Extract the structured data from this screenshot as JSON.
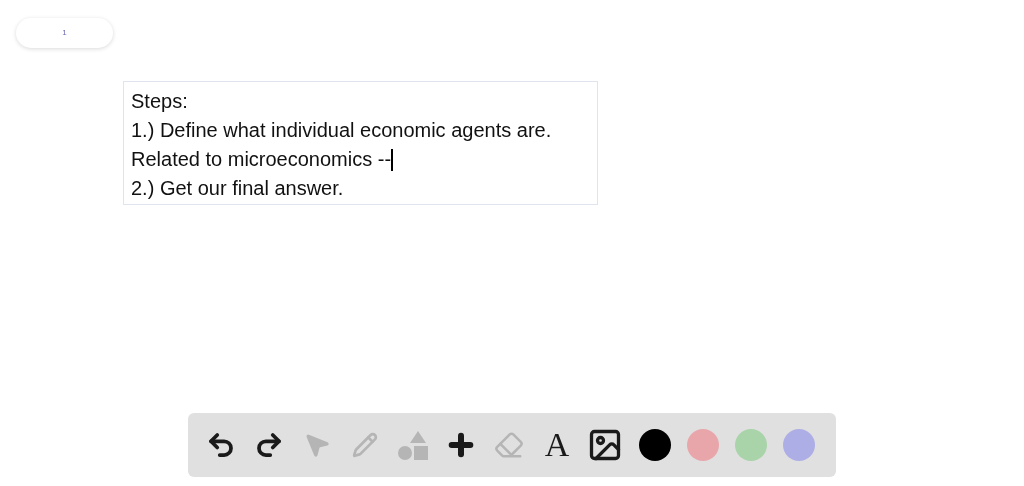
{
  "page_badge": "1",
  "text_box": {
    "lines": [
      "Steps:",
      "1.) Define what individual economic agents are.",
      "Related to microeconomics --",
      "2.) Get our final answer."
    ]
  },
  "toolbar": {
    "tools": [
      {
        "kind": "undo",
        "disabled": false
      },
      {
        "kind": "redo",
        "disabled": false
      },
      {
        "kind": "select",
        "disabled": true
      },
      {
        "kind": "pencil",
        "disabled": true
      },
      {
        "kind": "shapes",
        "disabled": true
      },
      {
        "kind": "add",
        "disabled": false
      },
      {
        "kind": "eraser",
        "disabled": true
      },
      {
        "kind": "text",
        "disabled": false,
        "label": "A"
      },
      {
        "kind": "image",
        "disabled": false
      }
    ],
    "colors": [
      {
        "color": "#000000"
      },
      {
        "color": "#e8a6ab"
      },
      {
        "color": "#a9d3a9"
      },
      {
        "color": "#aeaee6"
      }
    ]
  }
}
